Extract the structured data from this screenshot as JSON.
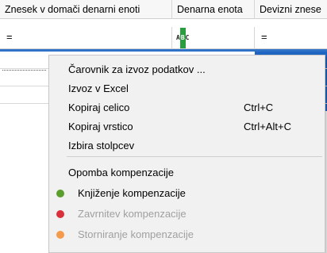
{
  "grid": {
    "columns": [
      "Znesek v domači denarni enoti",
      "Denarna enota",
      "Devizni znese"
    ],
    "filter_symbols": [
      "=",
      "ABC",
      "="
    ]
  },
  "menu": {
    "items": [
      {
        "label": "Čarovnik za izvoz podatkov ...",
        "shortcut": ""
      },
      {
        "label": "Izvoz v Excel",
        "shortcut": ""
      },
      {
        "label": "Kopiraj celico",
        "shortcut": "Ctrl+C"
      },
      {
        "label": "Kopiraj vrstico",
        "shortcut": "Ctrl+Alt+C"
      },
      {
        "label": "Izbira stolpcev",
        "shortcut": ""
      }
    ],
    "actions": [
      {
        "label": "Opomba kompenzacije",
        "enabled": true
      },
      {
        "label": "Knjiženje kompenzacije",
        "enabled": true,
        "icon": "green-dot-icon",
        "color": "#5a9e2e"
      },
      {
        "label": "Zavrnitev kompenzacije",
        "enabled": false,
        "icon": "red-dot-icon",
        "color": "#d9303b"
      },
      {
        "label": "Storniranje kompenzacije",
        "enabled": false,
        "icon": "orange-dot-icon",
        "color": "#f59a4c"
      }
    ]
  },
  "colors": {
    "selection": "#1f66c2",
    "menu_background": "#f1f1f1",
    "disabled_text": "#a0a0a0"
  }
}
